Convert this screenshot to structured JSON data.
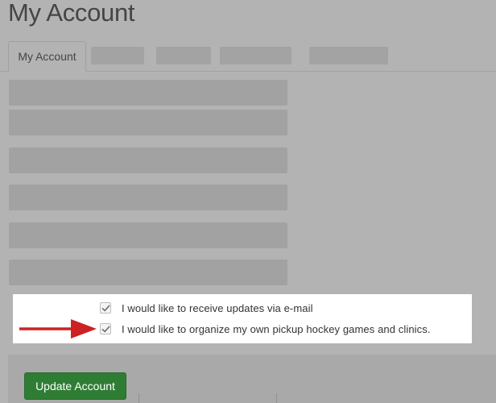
{
  "header": {
    "title": "My Account"
  },
  "tabs": [
    {
      "label": "My Account",
      "active": true
    },
    {
      "label": "",
      "active": false
    },
    {
      "label": "",
      "active": false
    },
    {
      "label": "",
      "active": false
    },
    {
      "label": "",
      "active": false
    }
  ],
  "form": {
    "fields": [
      "",
      "",
      "",
      "",
      "",
      ""
    ]
  },
  "preferences": {
    "email_updates": {
      "label": "I would like to receive updates via e-mail",
      "checked": true
    },
    "organize_games": {
      "label": "I would like to organize my own pickup hockey games and clinics.",
      "checked": true
    }
  },
  "annotation": {
    "arrow_color": "#cc2222",
    "arrow_icon": "arrow-right-icon"
  },
  "colors": {
    "button_green": "#2f7d34",
    "overlay_gray": "#b3b3b3"
  },
  "actions": {
    "update_label": "Update Account"
  }
}
